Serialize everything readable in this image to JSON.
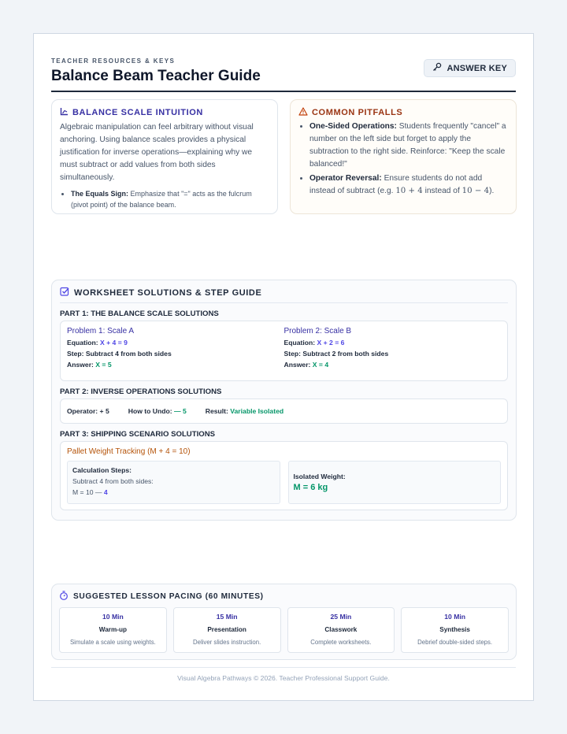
{
  "header": {
    "eyebrow": "TEACHER RESOURCES & KEYS",
    "title": "Balance Beam Teacher Guide",
    "answer_key_label": "ANSWER KEY"
  },
  "intuition": {
    "title": "BALANCE SCALE INTUITION",
    "body": "Algebraic manipulation can feel arbitrary without visual anchoring. Using balance scales provides a physical justification for inverse operations—explaining why we must subtract or add values from both sides simultaneously.",
    "bullet_label": "The Equals Sign:",
    "bullet_text": "Emphasize that \"=\" acts as the fulcrum (pivot point) of the balance beam."
  },
  "pitfalls": {
    "title": "COMMON PITFALLS",
    "item1_label": "One-Sided Operations:",
    "item1_text": "Students frequently \"cancel\" a number on the left side but forget to apply the subtraction to the right side. Reinforce: \"Keep the scale balanced!\"",
    "item2_label": "Operator Reversal:",
    "item2_text_a": "Ensure students do not add instead of subtract (e.g.",
    "item2_expr1": "10 + 4",
    "item2_text_b": "instead of",
    "item2_expr2": "10 − 4",
    "item2_text_c": ")."
  },
  "worksheet": {
    "title": "WORKSHEET SOLUTIONS & STEP GUIDE",
    "part1_title": "PART 1: THE BALANCE SCALE SOLUTIONS",
    "problems": [
      {
        "title": "Problem 1: Scale A",
        "eq_label": "Equation:",
        "equation": "X + 4 = 9",
        "step": "Step: Subtract 4 from both sides",
        "ans_label": "Answer:",
        "answer": "X = 5"
      },
      {
        "title": "Problem 2: Scale B",
        "eq_label": "Equation:",
        "equation": "X + 2 = 6",
        "step": "Step: Subtract 2 from both sides",
        "ans_label": "Answer:",
        "answer": "X = 4"
      }
    ],
    "part2_title": "PART 2: INVERSE OPERATIONS SOLUTIONS",
    "part2": {
      "operator_label": "Operator:",
      "operator": "+ 5",
      "undo_label": "How to Undo:",
      "undo": "— 5",
      "result_label": "Result:",
      "result": "Variable Isolated"
    },
    "part3_title": "PART 3: SHIPPING SCENARIO SOLUTIONS",
    "part3": {
      "scenario_title": "Pallet Weight Tracking (M + 4 = 10)",
      "calc_title": "Calculation Steps:",
      "calc_line1": "Subtract 4 from both sides:",
      "calc_line2_prefix": "M = 10 —",
      "calc_line2_value": "4",
      "iso_label": "Isolated Weight:",
      "iso_value": "M = 6 kg"
    }
  },
  "pacing": {
    "title": "SUGGESTED LESSON PACING (60 MINUTES)",
    "tiles": [
      {
        "duration": "10 Min",
        "name": "Warm-up",
        "desc": "Simulate a scale using weights."
      },
      {
        "duration": "15 Min",
        "name": "Presentation",
        "desc": "Deliver slides instruction."
      },
      {
        "duration": "25 Min",
        "name": "Classwork",
        "desc": "Complete worksheets."
      },
      {
        "duration": "10 Min",
        "name": "Synthesis",
        "desc": "Debrief double-sided steps."
      }
    ]
  },
  "footer": "Visual Algebra Pathways © 2026. Teacher Professional Support Guide.",
  "colors": {
    "indigo": "#3730a3",
    "orange": "#9a3412",
    "green": "#059669"
  },
  "icons": [
    "key-icon",
    "scale-icon",
    "warning-icon",
    "checkbox-icon",
    "stopwatch-icon"
  ]
}
